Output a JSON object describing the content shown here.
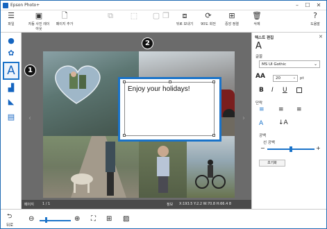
{
  "window": {
    "title": "Epson Photo+"
  },
  "toolbar": {
    "file": "파일",
    "auto_photo": "자동 사진 레이아웃",
    "add_page": "페이지 추가",
    "disabled1": "",
    "disabled2": "",
    "disabled3": "",
    "disabled4": "",
    "bring_front": "뒤로 보내기",
    "rotate": "90도 회전",
    "center": "중앙 정렬",
    "delete": "삭제",
    "help": "도움말"
  },
  "canvas": {
    "text_content": "Enjoy your holidays!"
  },
  "status": {
    "page_label": "페이지",
    "page_value": "1 / 1",
    "info_label": "정보",
    "info_value": "X:193.5  Y:2.2  W:70.8  H:66.4  8"
  },
  "properties": {
    "title": "텍스트 편집",
    "font_label": "글꼴",
    "font_value": "MS UI Gothic",
    "size_value": "20",
    "size_unit": "pt",
    "paragraph_label": "단락",
    "spacing_label": "공백",
    "line_spacing_label": "선 공백",
    "reset_button": "초기화"
  },
  "bottom": {
    "back_label": "뒤로"
  },
  "callouts": {
    "one": "1",
    "two": "2"
  },
  "colors": {
    "accent": "#1a73c9",
    "workspace": "#6b6b6b"
  }
}
